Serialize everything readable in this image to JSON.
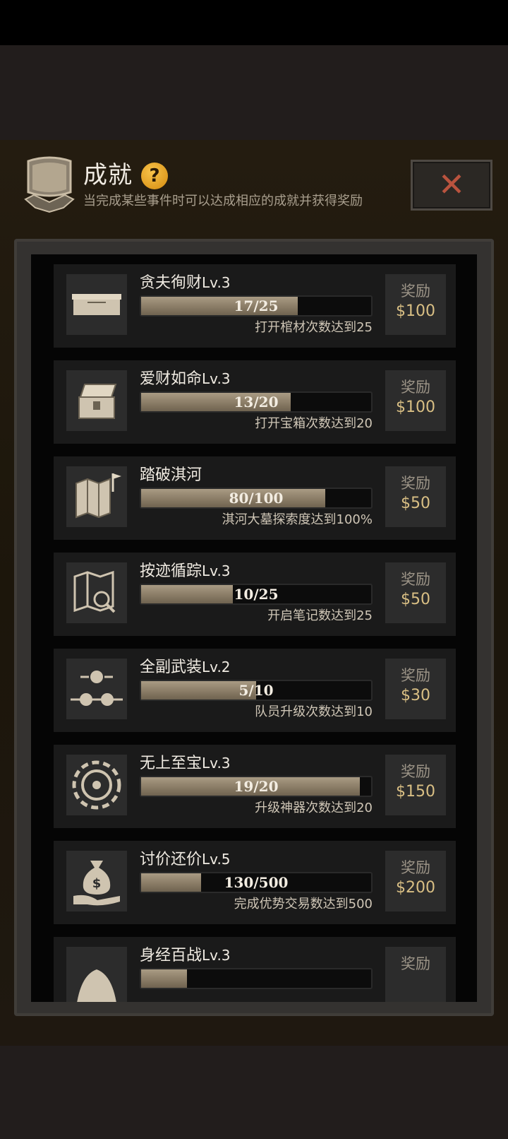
{
  "header": {
    "title": "成就",
    "help_icon": "question-mark-icon",
    "help_label": "?",
    "subtitle": "当完成某些事件时可以达成相应的成就并获得奖励",
    "close_label": "✕"
  },
  "colors": {
    "accent_gold": "#d9bf84",
    "close_red": "#b9533e",
    "help_orange": "#f0a81f"
  },
  "achievements": [
    {
      "name": "贪夫徇财",
      "level": "Lv.3",
      "progress": "17/25",
      "fraction": 0.68,
      "desc": "打开棺材次数达到25",
      "reward_label": "奖励",
      "reward": "$100",
      "icon": "coffin-icon"
    },
    {
      "name": "爱财如命",
      "level": "Lv.3",
      "progress": "13/20",
      "fraction": 0.65,
      "desc": "打开宝箱次数达到20",
      "reward_label": "奖励",
      "reward": "$100",
      "icon": "treasure-chest-icon"
    },
    {
      "name": "踏破淇河",
      "level": "",
      "progress": "80/100",
      "fraction": 0.8,
      "desc": "淇河大墓探索度达到100%",
      "reward_label": "奖励",
      "reward": "$50",
      "icon": "map-flag-icon"
    },
    {
      "name": "按迹循踪",
      "level": "Lv.3",
      "progress": "10/25",
      "fraction": 0.4,
      "desc": "开启笔记数达到25",
      "reward_label": "奖励",
      "reward": "$50",
      "icon": "map-search-icon"
    },
    {
      "name": "全副武装",
      "level": "Lv.2",
      "progress": "5/10",
      "fraction": 0.5,
      "desc": "队员升级次数达到10",
      "reward_label": "奖励",
      "reward": "$30",
      "icon": "rank-stars-icon"
    },
    {
      "name": "无上至宝",
      "level": "Lv.3",
      "progress": "19/20",
      "fraction": 0.95,
      "desc": "升级神器次数达到20",
      "reward_label": "奖励",
      "reward": "$150",
      "icon": "artifact-disc-icon"
    },
    {
      "name": "讨价还价",
      "level": "Lv.5",
      "progress": "130/500",
      "fraction": 0.26,
      "desc": "完成优势交易数达到500",
      "reward_label": "奖励",
      "reward": "$200",
      "icon": "money-bag-hand-icon"
    },
    {
      "name": "身经百战",
      "level": "Lv.3",
      "progress": "",
      "fraction": 0.2,
      "desc": "",
      "reward_label": "奖励",
      "reward": "",
      "icon": "battle-icon"
    }
  ]
}
